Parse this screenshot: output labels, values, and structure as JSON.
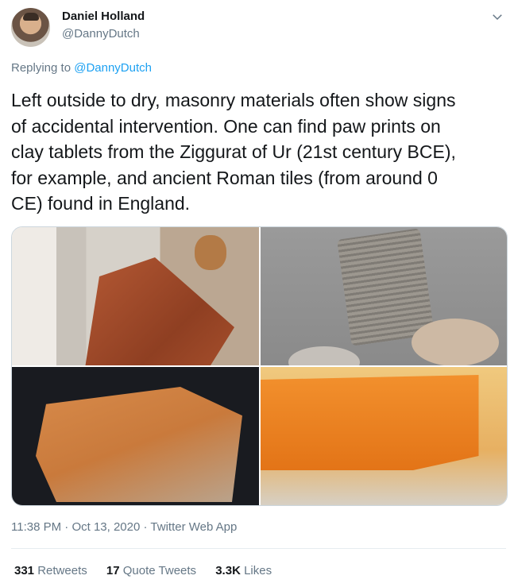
{
  "author": {
    "name": "Daniel Holland",
    "handle": "@DannyDutch"
  },
  "reply": {
    "prefix": "Replying to",
    "to": "@DannyDutch"
  },
  "tweet": {
    "text_lines": [
      "Left outside to dry, masonry materials often show signs",
      "of accidental intervention. One can find paw prints on",
      "clay tablets from the Ziggurat of Ur (21st century BCE),",
      "for example, and ancient Roman tiles (from around 0",
      "CE) found in England."
    ]
  },
  "media": {
    "count": 4
  },
  "meta": {
    "time": "11:38 PM",
    "date": "Oct 13, 2020",
    "client": "Twitter Web App",
    "separator": "·"
  },
  "stats": {
    "retweets": {
      "value": "331",
      "label": "Retweets"
    },
    "quotes": {
      "value": "17",
      "label": "Quote Tweets"
    },
    "likes": {
      "value": "3.3K",
      "label": "Likes"
    }
  },
  "icons": {
    "menu": "chevron-down-icon"
  },
  "colors": {
    "link": "#1da1f2",
    "secondary": "#657786",
    "text": "#14171a"
  }
}
